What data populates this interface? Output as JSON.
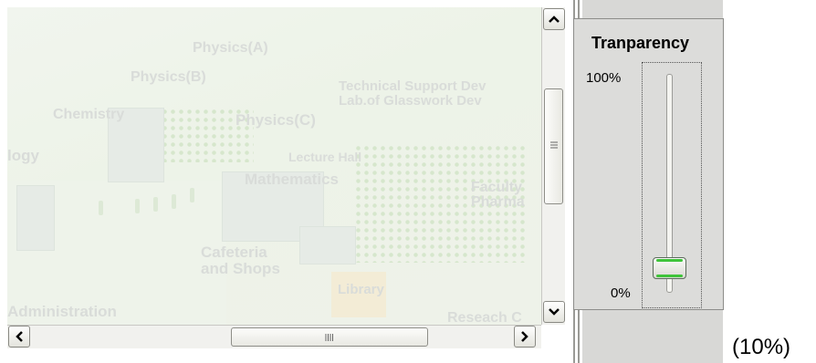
{
  "map": {
    "labels": [
      {
        "text": "Physics(A)"
      },
      {
        "text": "Physics(B)"
      },
      {
        "text": "Technical Support Dev"
      },
      {
        "text": "Lab.of Glasswork Dev"
      },
      {
        "text": "Chemistry"
      },
      {
        "text": "Physics(C)"
      },
      {
        "text": "logy"
      },
      {
        "text": "Lecture Hall"
      },
      {
        "text": "Mathematics"
      },
      {
        "text": "Faculty"
      },
      {
        "text": "Pharma"
      },
      {
        "text": "Cafeteria"
      },
      {
        "text": "and Shops"
      },
      {
        "text": "Library"
      },
      {
        "text": "Administration"
      },
      {
        "text": "Reseach C"
      }
    ]
  },
  "vertical_scrollbar": {
    "up_icon": "arrow-up-icon",
    "down_icon": "arrow-down-icon",
    "thumb_grip": "≡"
  },
  "horizontal_scrollbar": {
    "left_icon": "arrow-left-icon",
    "right_icon": "arrow-right-icon",
    "thumb_grip": "||||"
  },
  "transparency_panel": {
    "title": "Tranparency",
    "max_label": "100%",
    "min_label": "0%",
    "value_fraction": 0.1
  },
  "value_display": "(10%)",
  "colors": {
    "slider_accent": "#3fc43a",
    "panel_bg": "#dcdcda",
    "map_label": "#d9dcd9"
  }
}
